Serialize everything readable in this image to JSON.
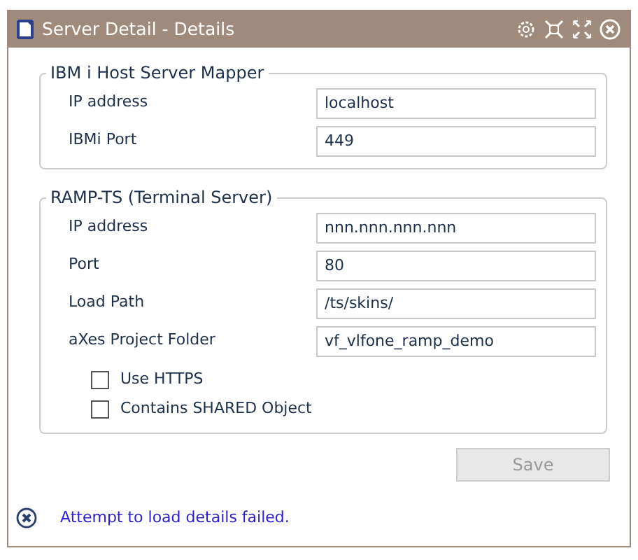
{
  "window": {
    "title": "Server Detail - Details"
  },
  "groups": [
    {
      "legend": "IBM i Host Server Mapper",
      "fields": [
        {
          "label": "IP address",
          "value": "localhost"
        },
        {
          "label": "IBMi Port",
          "value": "449"
        }
      ]
    },
    {
      "legend": "RAMP-TS (Terminal Server)",
      "fields": [
        {
          "label": "IP address",
          "value": "nnn.nnn.nnn.nnn"
        },
        {
          "label": "Port",
          "value": "80"
        },
        {
          "label": "Load Path",
          "value": "/ts/skins/"
        },
        {
          "label": "aXes Project Folder",
          "value": "vf_vlfone_ramp_demo"
        }
      ],
      "checkboxes": [
        {
          "label": "Use HTTPS",
          "checked": false
        },
        {
          "label": "Contains SHARED Object",
          "checked": false
        }
      ]
    }
  ],
  "save_button": {
    "label": "Save",
    "disabled": true
  },
  "message": {
    "text": "Attempt to load details failed."
  }
}
